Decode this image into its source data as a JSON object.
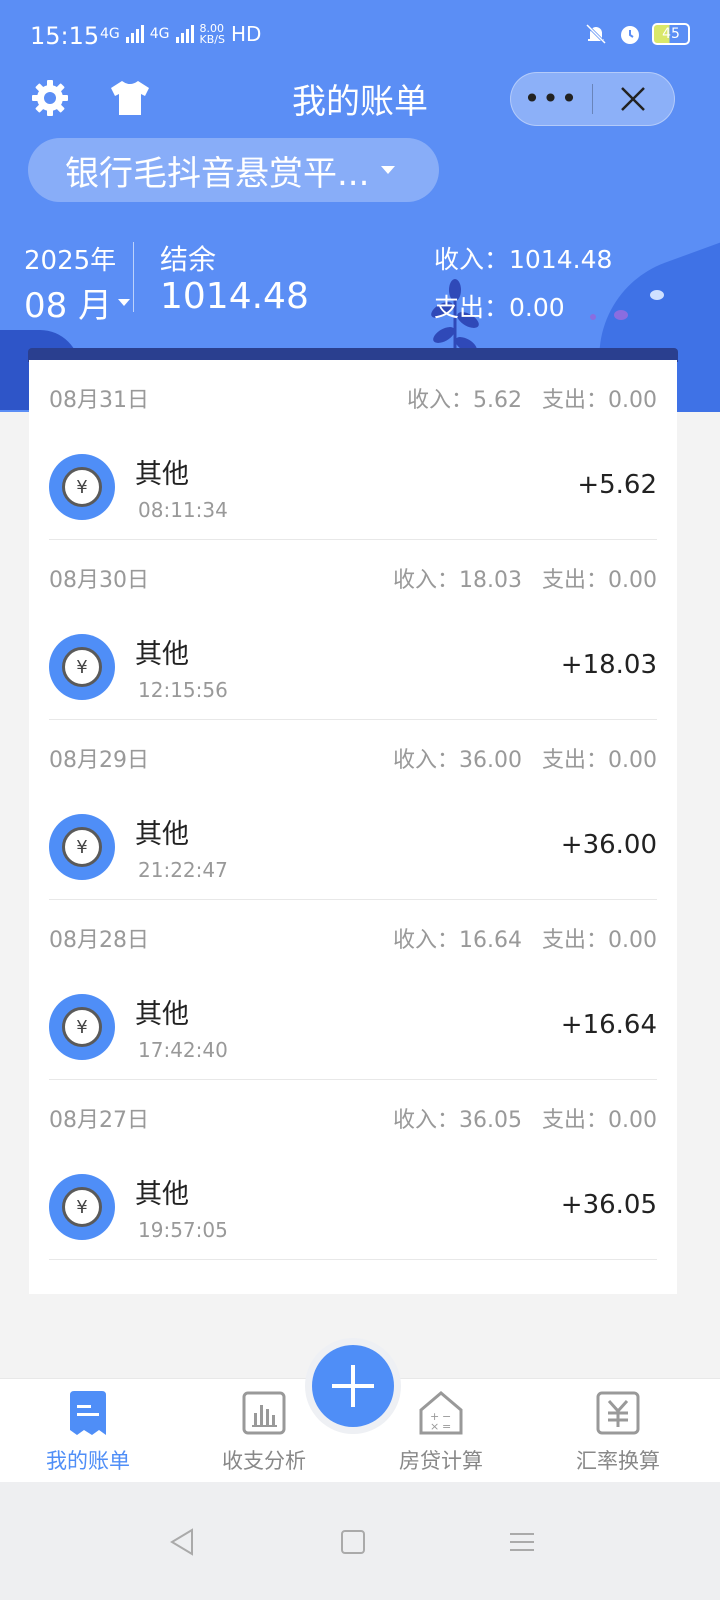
{
  "status_bar": {
    "time": "15:15",
    "net1": "4G",
    "net2": "4G",
    "speed_top": "8.00",
    "speed_unit": "KB/S",
    "hd": "HD",
    "battery": "45"
  },
  "header": {
    "title": "我的账单",
    "more_label": "•••",
    "book_name": "银行毛抖音悬赏平...",
    "year": "2025年",
    "month": "08 月",
    "balance_label": "结余",
    "balance_value": "1014.48",
    "income_text": "收入：1014.48",
    "expense_text": "支出：0.00"
  },
  "days": [
    {
      "date": "08月31日",
      "income": "收入：5.62",
      "expense": "支出：0.00",
      "category": "其他",
      "time": "08:11:34",
      "amount": "+5.62"
    },
    {
      "date": "08月30日",
      "income": "收入：18.03",
      "expense": "支出：0.00",
      "category": "其他",
      "time": "12:15:56",
      "amount": "+18.03"
    },
    {
      "date": "08月29日",
      "income": "收入：36.00",
      "expense": "支出：0.00",
      "category": "其他",
      "time": "21:22:47",
      "amount": "+36.00"
    },
    {
      "date": "08月28日",
      "income": "收入：16.64",
      "expense": "支出：0.00",
      "category": "其他",
      "time": "17:42:40",
      "amount": "+16.64"
    },
    {
      "date": "08月27日",
      "income": "收入：36.05",
      "expense": "支出：0.00",
      "category": "其他",
      "time": "19:57:05",
      "amount": "+36.05"
    }
  ],
  "tabs": [
    {
      "label": "我的账单"
    },
    {
      "label": "收支分析"
    },
    {
      "label": "房贷计算"
    },
    {
      "label": "汇率换算"
    }
  ],
  "icons": {
    "category_glyph": "¥"
  },
  "colors": {
    "primary": "#5b8ef5",
    "accent": "#4f8ef7"
  }
}
